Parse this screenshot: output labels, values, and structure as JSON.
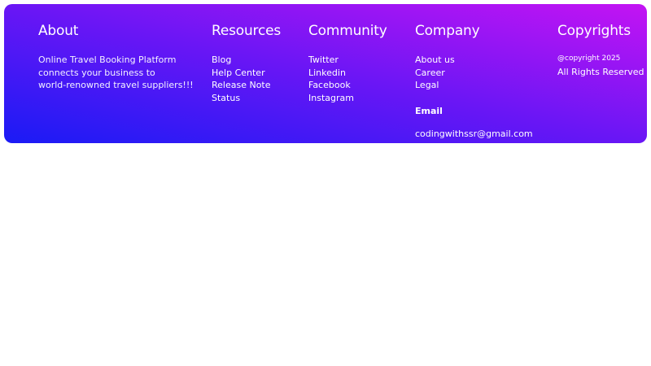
{
  "colors": {
    "gradient_start": "#1a1bf5",
    "gradient_mid": "#6a16f5",
    "gradient_end": "#c414f3",
    "text": "#ffffff",
    "page_background": "#ffffff"
  },
  "about": {
    "heading": "About",
    "lines": [
      "Online Travel Booking Platform",
      "connects your business to",
      "world-renowned travel suppliers!!!"
    ]
  },
  "resources": {
    "heading": "Resources",
    "links": [
      "Blog",
      "Help Center",
      "Release Note",
      "Status"
    ]
  },
  "community": {
    "heading": "Community",
    "links": [
      "Twitter",
      "Linkedin",
      "Facebook",
      "Instagram"
    ]
  },
  "company": {
    "heading": "Company",
    "links": [
      "About us",
      "Career",
      "Legal"
    ],
    "email_label": "Email",
    "email": "codingwithssr@gmail.com"
  },
  "copyrights": {
    "heading": "Copyrights",
    "notice": "@copyright 2025",
    "rights": "All Rights Reserved"
  }
}
